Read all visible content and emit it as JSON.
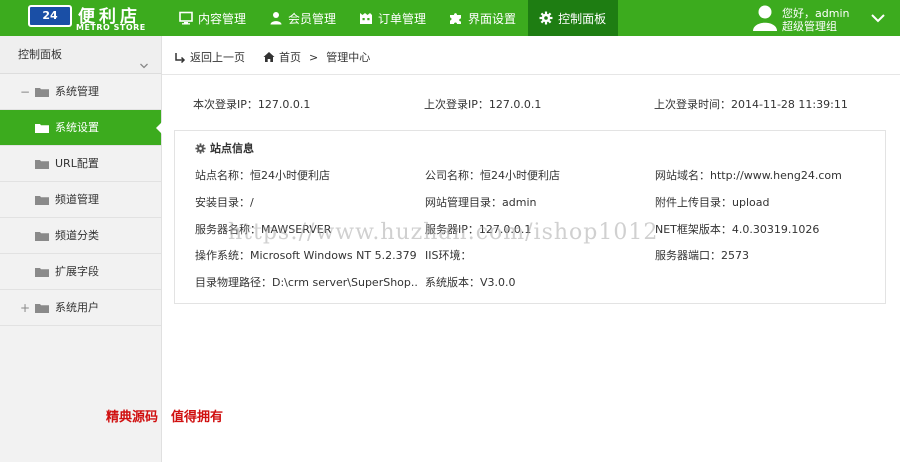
{
  "brand": {
    "badge": "24",
    "name": "便利店",
    "sub": "METRO STORE"
  },
  "nav": [
    {
      "label": "内容管理",
      "icon": "monitor-icon"
    },
    {
      "label": "会员管理",
      "icon": "user-icon"
    },
    {
      "label": "订单管理",
      "icon": "orders-icon"
    },
    {
      "label": "界面设置",
      "icon": "puzzle-icon"
    },
    {
      "label": "控制面板",
      "icon": "gear-icon",
      "active": true
    }
  ],
  "user": {
    "greeting": "您好，admin",
    "role": "超级管理组"
  },
  "sidebar": {
    "header": "控制面板",
    "items": [
      {
        "label": "系统管理",
        "toggle": "−",
        "level": 0
      },
      {
        "label": "系统设置",
        "level": 1,
        "active": true
      },
      {
        "label": "URL配置",
        "level": 1
      },
      {
        "label": "频道管理",
        "level": 1
      },
      {
        "label": "频道分类",
        "level": 1
      },
      {
        "label": "扩展字段",
        "level": 1
      },
      {
        "label": "系统用户",
        "toggle": "+",
        "level": 0
      }
    ]
  },
  "breadcrumb": {
    "back": "返回上一页",
    "home": "首页",
    "sep": ">",
    "current": "管理中心"
  },
  "login": {
    "this_ip": "本次登录IP：127.0.0.1",
    "last_ip": "上次登录IP：127.0.0.1",
    "last_time": "上次登录时间：2014-11-28 11:39:11"
  },
  "site_info": {
    "title": "站点信息",
    "rows": [
      [
        "站点名称：恒24小时便利店",
        "公司名称：恒24小时便利店",
        "网站域名：http://www.heng24.com"
      ],
      [
        "安装目录：/",
        "网站管理目录：admin",
        "附件上传目录：upload"
      ],
      [
        "服务器名称：MAWSERVER",
        "服务器IP：127.0.0.1",
        "NET框架版本：4.0.30319.1026"
      ],
      [
        "操作系统：Microsoft Windows NT 5.2.379...",
        "IIS环境：",
        "服务器端口：2573"
      ],
      [
        "目录物理路径：D:\\crm server\\SuperShop...",
        "系统版本：V3.0.0",
        ""
      ]
    ]
  },
  "watermark": "https://www.huzhan.com/ishop1012",
  "promo": "精典源码　值得拥有",
  "colors": {
    "accent": "#3cab1e",
    "accent_dark": "#1e7d12",
    "promo": "#d01010"
  }
}
